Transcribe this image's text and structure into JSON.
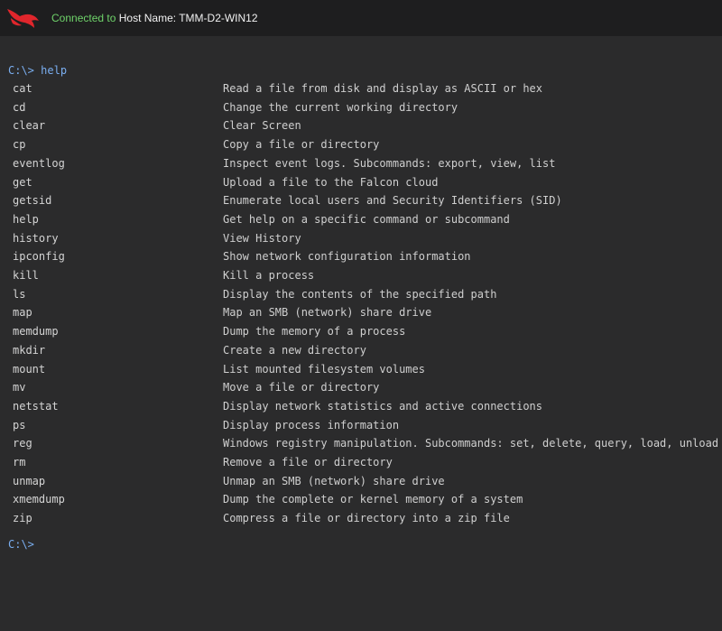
{
  "header": {
    "status_text": "Connected to",
    "host_text": "Host Name: TMM-D2-WIN12",
    "logo_icon": "falcon-logo-icon",
    "accent_color": "#e0262c",
    "status_color": "#6fd36a"
  },
  "terminal": {
    "first_prompt": "C:\\>",
    "first_command": "help",
    "last_prompt": "C:\\>",
    "commands": [
      {
        "name": "cat",
        "desc": "Read a file from disk and display as ASCII or hex"
      },
      {
        "name": "cd",
        "desc": "Change the current working directory"
      },
      {
        "name": "clear",
        "desc": "Clear Screen"
      },
      {
        "name": "cp",
        "desc": "Copy a file or directory"
      },
      {
        "name": "eventlog",
        "desc": "Inspect event logs. Subcommands: export, view, list"
      },
      {
        "name": "get",
        "desc": "Upload a file to the Falcon cloud"
      },
      {
        "name": "getsid",
        "desc": "Enumerate local users and Security Identifiers (SID)"
      },
      {
        "name": "help",
        "desc": "Get help on a specific command or subcommand"
      },
      {
        "name": "history",
        "desc": "View History"
      },
      {
        "name": "ipconfig",
        "desc": "Show network configuration information"
      },
      {
        "name": "kill",
        "desc": "Kill a process"
      },
      {
        "name": "ls",
        "desc": "Display the contents of the specified path"
      },
      {
        "name": "map",
        "desc": "Map an SMB (network) share drive"
      },
      {
        "name": "memdump",
        "desc": "Dump the memory of a process"
      },
      {
        "name": "mkdir",
        "desc": "Create a new directory"
      },
      {
        "name": "mount",
        "desc": "List mounted filesystem volumes"
      },
      {
        "name": "mv",
        "desc": "Move a file or directory"
      },
      {
        "name": "netstat",
        "desc": "Display network statistics and active connections"
      },
      {
        "name": "ps",
        "desc": "Display process information"
      },
      {
        "name": "reg",
        "desc": "Windows registry manipulation. Subcommands: set, delete, query, load, unload"
      },
      {
        "name": "rm",
        "desc": "Remove a file or directory"
      },
      {
        "name": "unmap",
        "desc": "Unmap an SMB (network) share drive"
      },
      {
        "name": "xmemdump",
        "desc": "Dump the complete or kernel memory of a system"
      },
      {
        "name": "zip",
        "desc": "Compress a file or directory into a zip file"
      }
    ]
  }
}
